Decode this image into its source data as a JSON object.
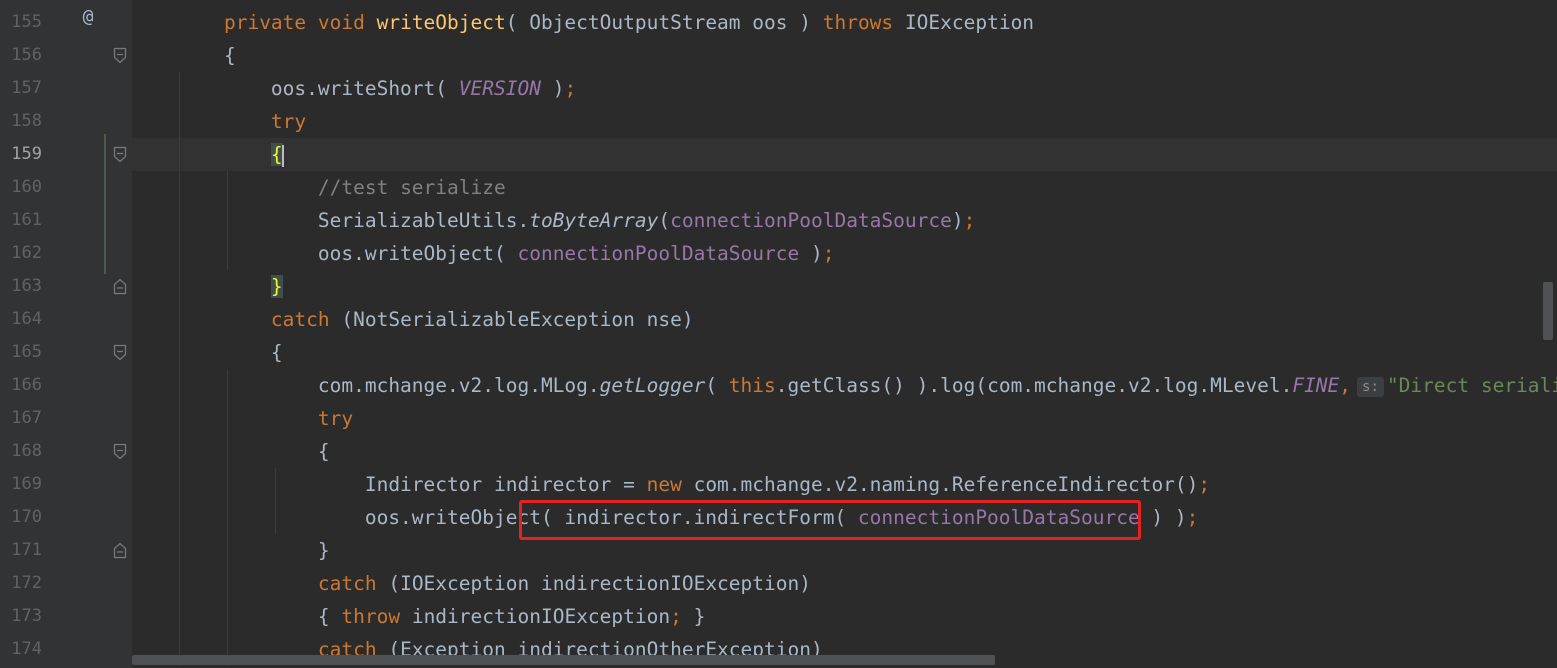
{
  "editor": {
    "current_line": "159",
    "gutter_icon": "@",
    "colors": {
      "background": "#2b2b2b",
      "gutter": "#313335",
      "keyword": "#cc7832",
      "method_decl": "#ffc66d",
      "field": "#9876aa",
      "comment": "#808080",
      "string": "#6a8759",
      "plain": "#a9b7c6",
      "highlight_box": "#e5231e"
    },
    "lines": [
      {
        "num": "155",
        "tokens": [
          {
            "t": "    "
          },
          {
            "t": "private void ",
            "c": "kw"
          },
          {
            "t": "writeObject",
            "c": "fn"
          },
          {
            "t": "( ObjectOutputStream oos ) "
          },
          {
            "t": "throws ",
            "c": "kw"
          },
          {
            "t": "IOException"
          }
        ]
      },
      {
        "num": "156",
        "tokens": [
          {
            "t": "    {"
          }
        ]
      },
      {
        "num": "157",
        "tokens": [
          {
            "t": "        oos.writeShort( "
          },
          {
            "t": "VERSION",
            "c": "st"
          },
          {
            "t": " )"
          },
          {
            "t": ";",
            "c": "kw"
          }
        ]
      },
      {
        "num": "158",
        "tokens": [
          {
            "t": "        "
          },
          {
            "t": "try",
            "c": "kw"
          }
        ]
      },
      {
        "num": "159",
        "tokens": [
          {
            "t": "        "
          },
          {
            "t": "{",
            "c": "brace-hl"
          },
          {
            "caret": true
          }
        ]
      },
      {
        "num": "160",
        "tokens": [
          {
            "t": "            "
          },
          {
            "t": "//test serialize",
            "c": "cm"
          }
        ]
      },
      {
        "num": "161",
        "tokens": [
          {
            "t": "            SerializableUtils."
          },
          {
            "t": "toByteArray",
            "c": "it"
          },
          {
            "t": "("
          },
          {
            "t": "connectionPoolDataSource",
            "c": "fld"
          },
          {
            "t": ")"
          },
          {
            "t": ";",
            "c": "kw"
          }
        ]
      },
      {
        "num": "162",
        "tokens": [
          {
            "t": "            oos.writeObject( "
          },
          {
            "t": "connectionPoolDataSource",
            "c": "fld"
          },
          {
            "t": " )"
          },
          {
            "t": ";",
            "c": "kw"
          }
        ]
      },
      {
        "num": "163",
        "tokens": [
          {
            "t": "        "
          },
          {
            "t": "}",
            "c": "brace-hl"
          }
        ]
      },
      {
        "num": "164",
        "tokens": [
          {
            "t": "        "
          },
          {
            "t": "catch",
            "c": "kw"
          },
          {
            "t": " (NotSerializableException nse)"
          }
        ]
      },
      {
        "num": "165",
        "tokens": [
          {
            "t": "        {"
          }
        ]
      },
      {
        "num": "166",
        "tokens": [
          {
            "t": "            com.mchange.v2.log.MLog."
          },
          {
            "t": "getLogger",
            "c": "it"
          },
          {
            "t": "( "
          },
          {
            "t": "this",
            "c": "kw"
          },
          {
            "t": ".getClass() ).log(com.mchange.v2.log.MLevel."
          },
          {
            "t": "FINE",
            "c": "st"
          },
          {
            "t": ",",
            "c": "kw"
          },
          {
            "hint": "s:"
          },
          {
            "t": "\"Direct seriali",
            "c": "strlit"
          }
        ]
      },
      {
        "num": "167",
        "tokens": [
          {
            "t": "            "
          },
          {
            "t": "try",
            "c": "kw"
          }
        ]
      },
      {
        "num": "168",
        "tokens": [
          {
            "t": "            {"
          }
        ]
      },
      {
        "num": "169",
        "tokens": [
          {
            "t": "                Indirector indirector = "
          },
          {
            "t": "new ",
            "c": "kw"
          },
          {
            "t": "com.mchange.v2.naming.ReferenceIndirector()"
          },
          {
            "t": ";",
            "c": "kw"
          }
        ]
      },
      {
        "num": "170",
        "tokens": [
          {
            "t": "                oos.writeObject( indirector.indirectForm( "
          },
          {
            "t": "connectionPoolDataSource",
            "c": "fld"
          },
          {
            "t": " ) )"
          },
          {
            "t": ";",
            "c": "kw"
          }
        ]
      },
      {
        "num": "171",
        "tokens": [
          {
            "t": "            }"
          }
        ]
      },
      {
        "num": "172",
        "tokens": [
          {
            "t": "            "
          },
          {
            "t": "catch",
            "c": "kw"
          },
          {
            "t": " (IOException indirectionIOException)"
          }
        ]
      },
      {
        "num": "173",
        "tokens": [
          {
            "t": "            { "
          },
          {
            "t": "throw ",
            "c": "kw"
          },
          {
            "t": "indirectionIOException"
          },
          {
            "t": ";",
            "c": "kw"
          },
          {
            "t": " }"
          }
        ]
      },
      {
        "num": "174",
        "tokens": [
          {
            "t": "            "
          },
          {
            "t": "catch",
            "c": "kw"
          },
          {
            "t": " (Exception indirectionOtherException)"
          }
        ]
      }
    ]
  }
}
